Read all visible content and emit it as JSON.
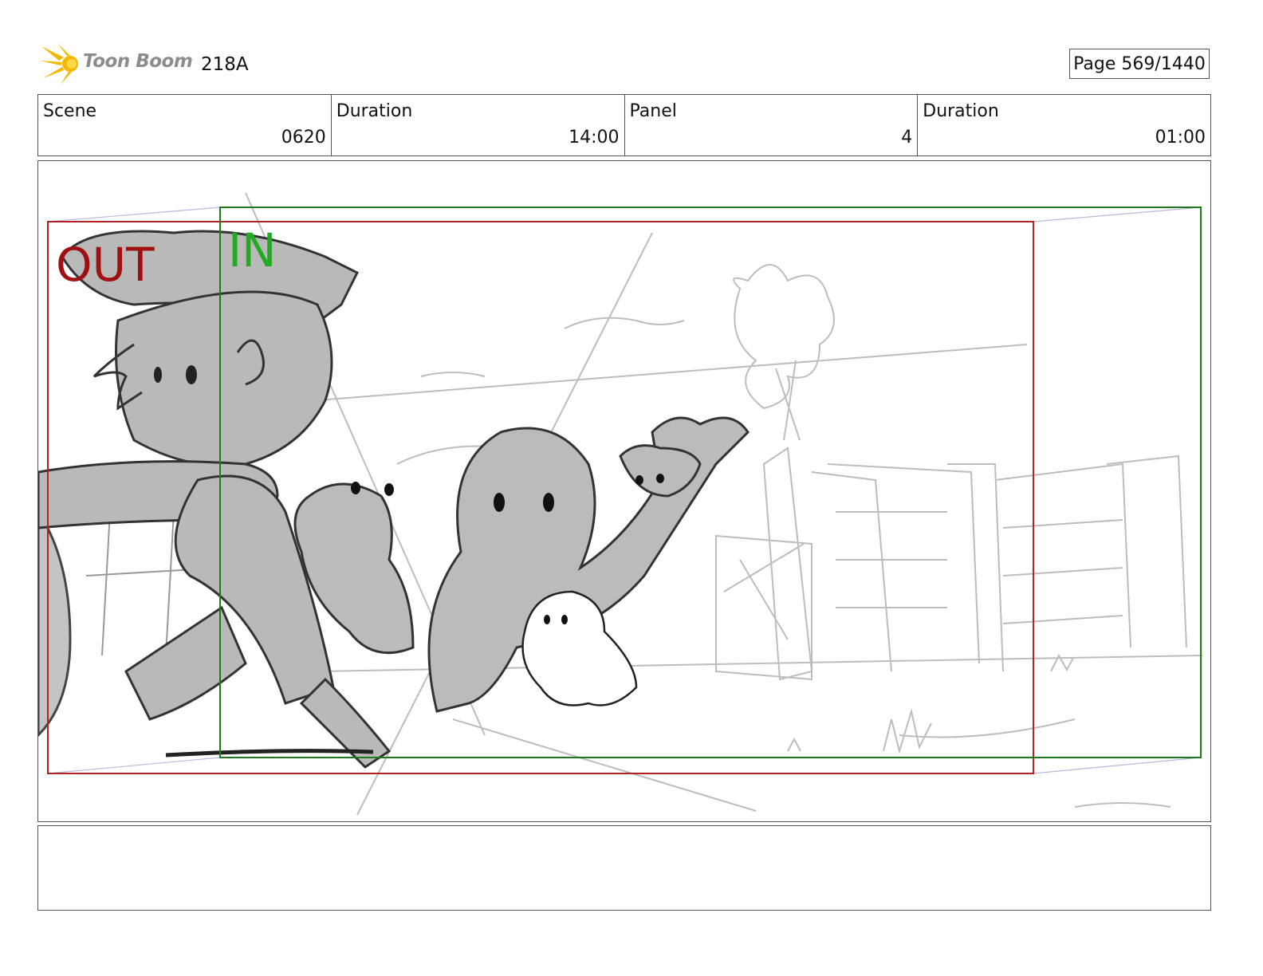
{
  "header": {
    "logo_text": "Toon Boom",
    "project_id": "218A",
    "page_label": "Page",
    "page_value": "569/1440"
  },
  "info": {
    "scene_label": "Scene",
    "scene_value": "0620",
    "scene_duration_label": "Duration",
    "scene_duration_value": "14:00",
    "panel_label": "Panel",
    "panel_value": "4",
    "panel_duration_label": "Duration",
    "panel_duration_value": "01:00"
  },
  "frame_labels": {
    "out": "OUT",
    "in": "IN"
  },
  "colors": {
    "out_frame": "#b22222",
    "in_frame": "#1e7a1e",
    "in_text": "#22aa22",
    "out_text": "#a01010",
    "logo_burst": "#f5b800",
    "sketch_fill": "#b9b9b9",
    "sketch_line": "#333333"
  },
  "caption": {
    "text": ""
  }
}
